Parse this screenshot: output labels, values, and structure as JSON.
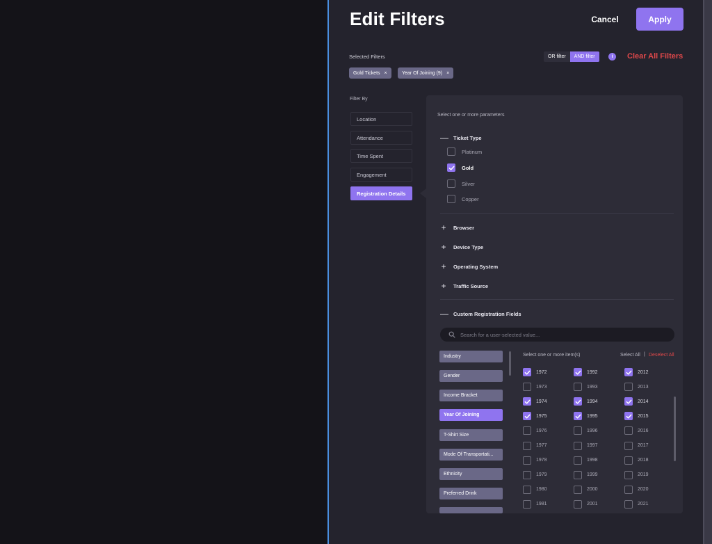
{
  "header": {
    "title": "Edit Filters",
    "cancel_label": "Cancel",
    "apply_label": "Apply"
  },
  "selected": {
    "label": "Selected Filters",
    "chips": [
      {
        "label": "Gold Tickets"
      },
      {
        "label": "Year Of Joining (9)"
      }
    ],
    "remove_glyph": "×",
    "toggle": {
      "or_label": "OR filter",
      "and_label": "AND filter",
      "active": "AND filter"
    },
    "info_glyph": "i",
    "clear_all_label": "Clear All Filters"
  },
  "filter_by": {
    "label": "Filter By",
    "items": [
      {
        "label": "Location"
      },
      {
        "label": "Attendance"
      },
      {
        "label": "Time Spent"
      },
      {
        "label": "Engagement"
      },
      {
        "label": "Registration Details"
      }
    ],
    "active": "Registration Details"
  },
  "params": {
    "hint": "Select one or more parameters",
    "ticket_type": {
      "title": "Ticket Type",
      "options": [
        {
          "label": "Platinum",
          "checked": false
        },
        {
          "label": "Gold",
          "checked": true
        },
        {
          "label": "Silver",
          "checked": false
        },
        {
          "label": "Copper",
          "checked": false
        }
      ]
    },
    "collapsed_sections": [
      {
        "title": "Browser"
      },
      {
        "title": "Device Type"
      },
      {
        "title": "Operating System"
      },
      {
        "title": "Traffic Source"
      }
    ],
    "custom": {
      "title": "Custom Registration Fields",
      "search_placeholder": "Search for a user-selected value...",
      "fields": [
        {
          "label": "Industry"
        },
        {
          "label": "Gender"
        },
        {
          "label": "Income Bracket"
        },
        {
          "label": "Year Of Joining"
        },
        {
          "label": "T-Shirt Size"
        },
        {
          "label": "Mode Of Transportati..."
        },
        {
          "label": "Ethnicity"
        },
        {
          "label": "Preferred Drink"
        }
      ],
      "active_field": "Year Of Joining",
      "items_hint": "Select one or more item(s)",
      "select_all_label": "Select All",
      "separator": "|",
      "deselect_all_label": "Deselect All",
      "years": [
        [
          {
            "label": "1972",
            "checked": true
          },
          {
            "label": "1992",
            "checked": true
          },
          {
            "label": "2012",
            "checked": true
          }
        ],
        [
          {
            "label": "1973",
            "checked": false
          },
          {
            "label": "1993",
            "checked": false
          },
          {
            "label": "2013",
            "checked": false
          }
        ],
        [
          {
            "label": "1974",
            "checked": true
          },
          {
            "label": "1994",
            "checked": true
          },
          {
            "label": "2014",
            "checked": true
          }
        ],
        [
          {
            "label": "1975",
            "checked": true
          },
          {
            "label": "1995",
            "checked": true
          },
          {
            "label": "2015",
            "checked": true
          }
        ],
        [
          {
            "label": "1976",
            "checked": false
          },
          {
            "label": "1996",
            "checked": false
          },
          {
            "label": "2016",
            "checked": false
          }
        ],
        [
          {
            "label": "1977",
            "checked": false
          },
          {
            "label": "1997",
            "checked": false
          },
          {
            "label": "2017",
            "checked": false
          }
        ],
        [
          {
            "label": "1978",
            "checked": false
          },
          {
            "label": "1998",
            "checked": false
          },
          {
            "label": "2018",
            "checked": false
          }
        ],
        [
          {
            "label": "1979",
            "checked": false
          },
          {
            "label": "1999",
            "checked": false
          },
          {
            "label": "2019",
            "checked": false
          }
        ],
        [
          {
            "label": "1980",
            "checked": false
          },
          {
            "label": "2000",
            "checked": false
          },
          {
            "label": "2020",
            "checked": false
          }
        ],
        [
          {
            "label": "1981",
            "checked": false
          },
          {
            "label": "2001",
            "checked": false
          },
          {
            "label": "2021",
            "checked": false
          }
        ]
      ]
    }
  },
  "colors": {
    "accent": "#8f74ef",
    "danger": "#e0484a",
    "panel_bg": "#24232d",
    "box_bg": "#2d2c37",
    "chip_bg": "#6a6887"
  }
}
